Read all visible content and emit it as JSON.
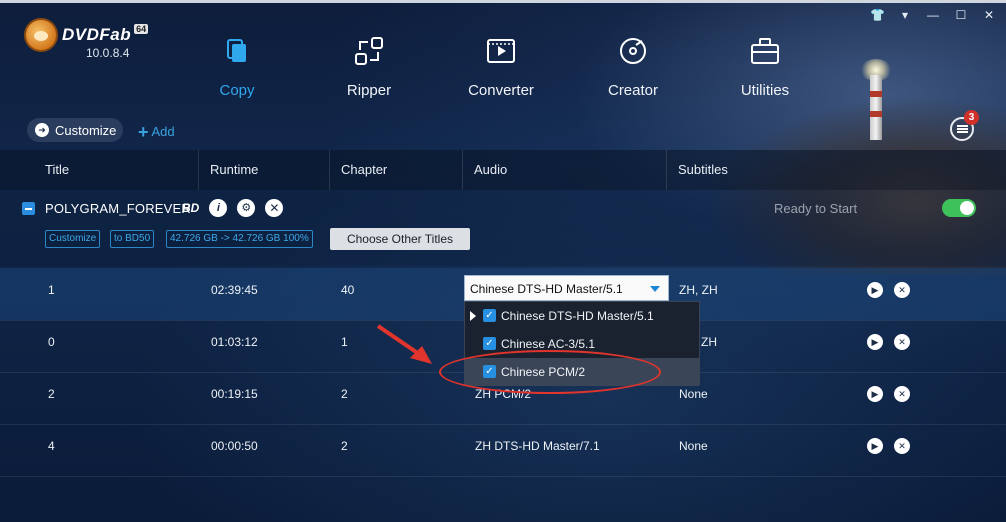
{
  "app": {
    "brand": "DVDFab",
    "bits": "64",
    "version": "10.0.8.4"
  },
  "window": {
    "controls": [
      "👕",
      "▾",
      "—",
      "☐",
      "✕"
    ]
  },
  "modules": [
    {
      "label": "Copy",
      "icon": "copy-icon",
      "active": true
    },
    {
      "label": "Ripper",
      "icon": "ripper-icon",
      "active": false
    },
    {
      "label": "Converter",
      "icon": "converter-icon",
      "active": false
    },
    {
      "label": "Creator",
      "icon": "creator-icon",
      "active": false
    },
    {
      "label": "Utilities",
      "icon": "utilities-icon",
      "active": false
    }
  ],
  "toolbar": {
    "customize_label": "Customize",
    "add_label": "Add",
    "task_badge": "3"
  },
  "columns": [
    "Title",
    "Runtime",
    "Chapter",
    "Audio",
    "Subtitles"
  ],
  "source": {
    "title": "POLYGRAM_FOREVER",
    "bd_icon": "BD",
    "status": "Ready to Start",
    "tags": [
      "Customize",
      "to BD50",
      "42.726 GB -> 42.726 GB 100%"
    ],
    "choose_label": "Choose Other Titles"
  },
  "rows": [
    {
      "title": "1",
      "runtime": "02:39:45",
      "chapter": "40",
      "audio": "Chinese DTS-HD Master/5.1",
      "subtitles": "ZH, ZH",
      "selected": true
    },
    {
      "title": "0",
      "runtime": "01:03:12",
      "chapter": "1",
      "audio": "",
      "subtitles": "ZH",
      "selected": false
    },
    {
      "title": "2",
      "runtime": "00:19:15",
      "chapter": "2",
      "audio": "ZH  PCM/2",
      "subtitles": "None",
      "selected": false
    },
    {
      "title": "4",
      "runtime": "00:00:50",
      "chapter": "2",
      "audio": "ZH  DTS-HD Master/7.1",
      "subtitles": "None",
      "selected": false
    }
  ],
  "audio_dropdown": {
    "options": [
      {
        "label": "Chinese DTS-HD Master/5.1",
        "checked": true,
        "pointer": true
      },
      {
        "label": "Chinese AC-3/5.1",
        "checked": true,
        "pointer": false
      },
      {
        "label": "Chinese PCM/2",
        "checked": true,
        "pointer": false
      }
    ]
  },
  "colors": {
    "accent": "#2fa8ee",
    "toggle_on": "#3ec15a",
    "annotation": "#e0342c"
  }
}
